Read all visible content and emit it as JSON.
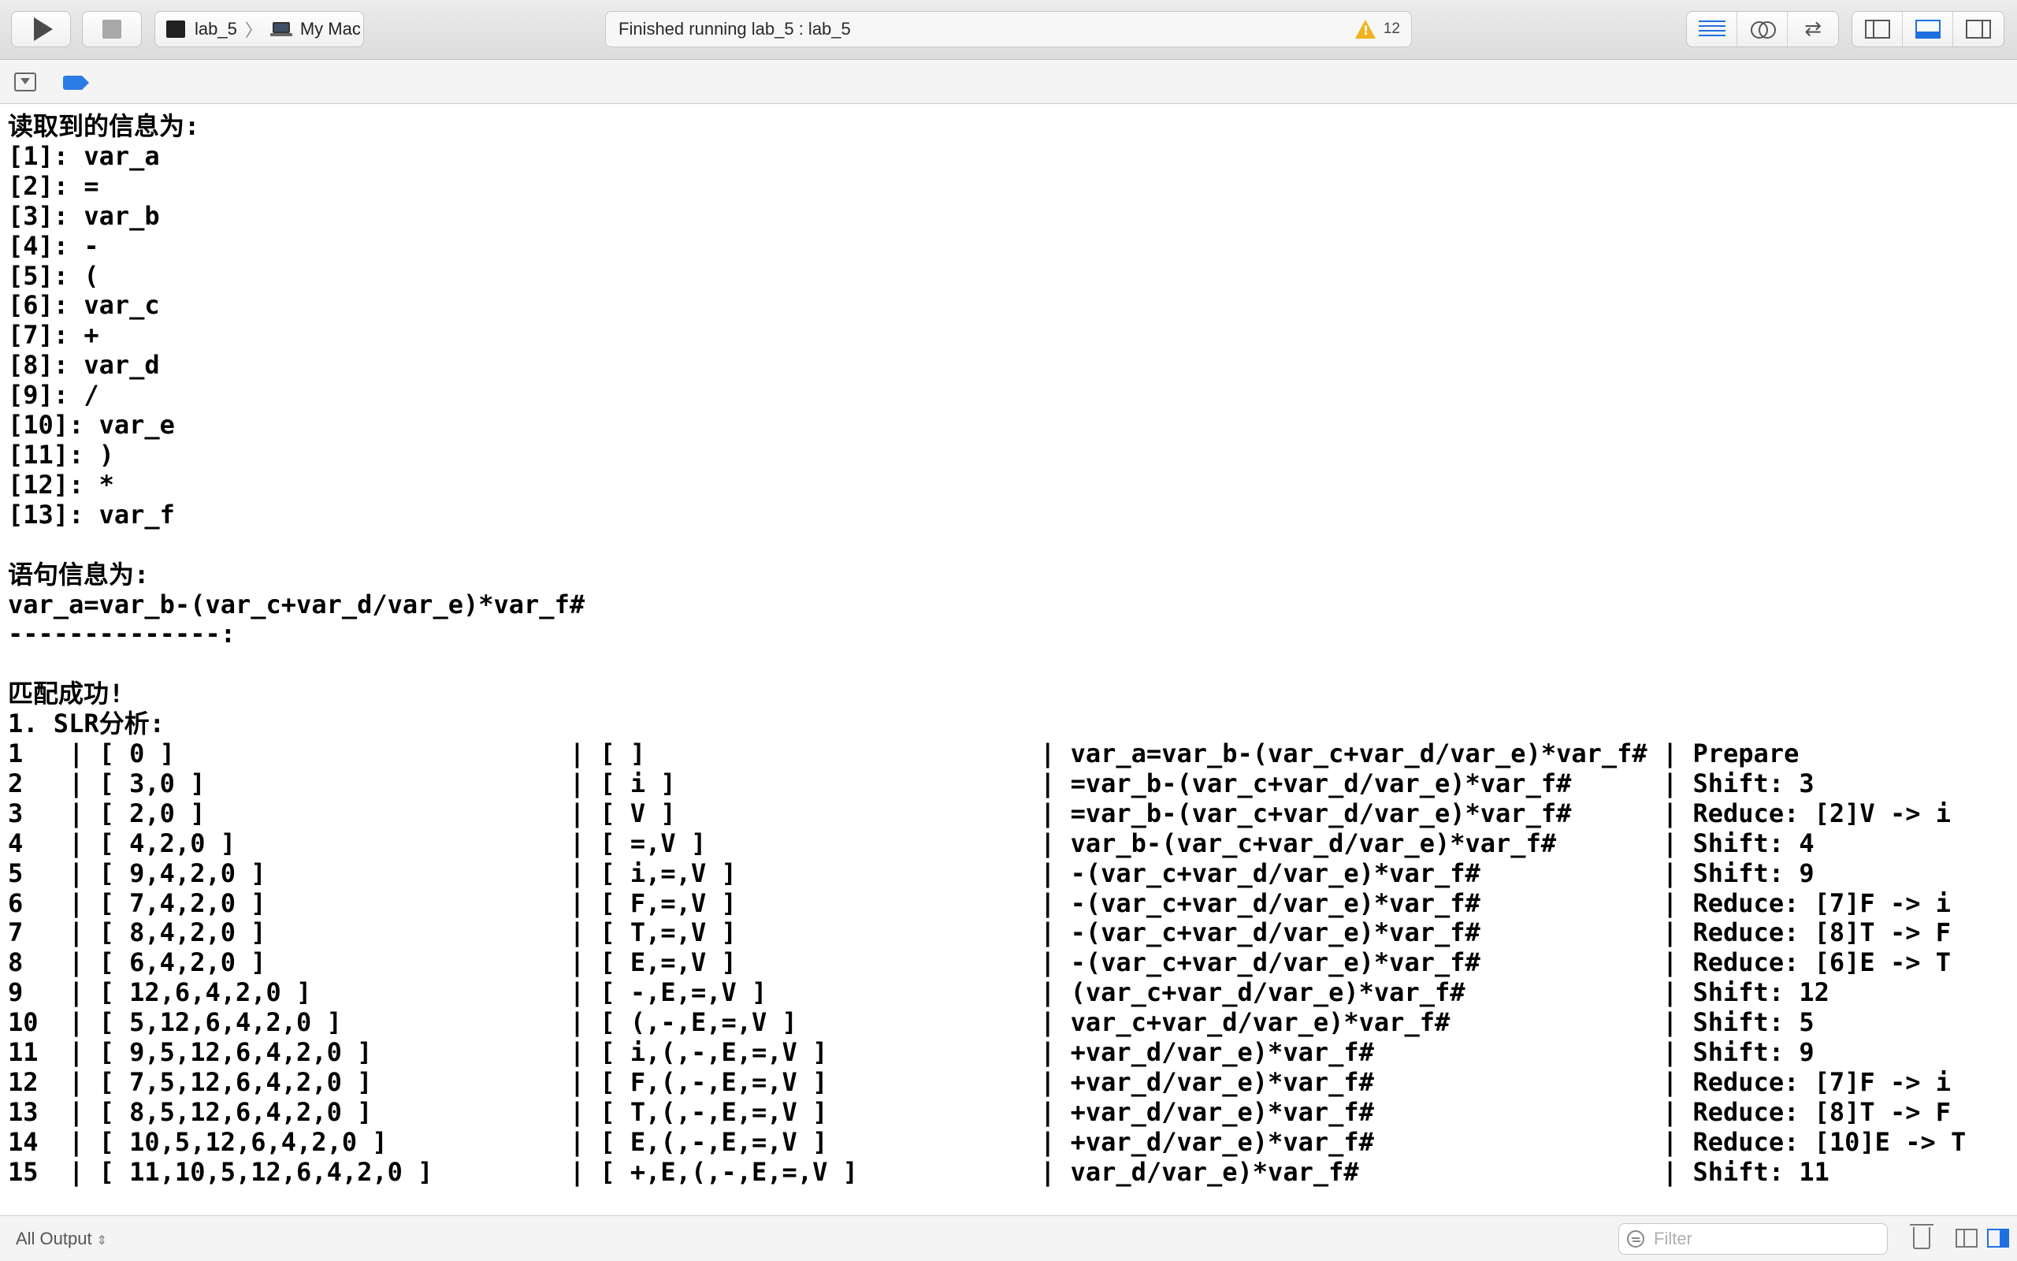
{
  "toolbar": {
    "scheme_target": "lab_5",
    "scheme_destination": "My Mac",
    "status_text": "Finished running lab_5 : lab_5",
    "warning_count": "12"
  },
  "console_lines": [
    "读取到的信息为:",
    "[1]: var_a",
    "[2]: =",
    "[3]: var_b",
    "[4]: -",
    "[5]: (",
    "[6]: var_c",
    "[7]: +",
    "[8]: var_d",
    "[9]: /",
    "[10]: var_e",
    "[11]: )",
    "[12]: *",
    "[13]: var_f",
    "",
    "语句信息为:",
    "var_a=var_b-(var_c+var_d/var_e)*var_f#",
    "--------------:",
    "",
    "匹配成功!",
    "1. SLR分析:",
    "1   | [ 0 ]                          | [ ]                          | var_a=var_b-(var_c+var_d/var_e)*var_f# | Prepare",
    "2   | [ 3,0 ]                        | [ i ]                        | =var_b-(var_c+var_d/var_e)*var_f#      | Shift: 3",
    "3   | [ 2,0 ]                        | [ V ]                        | =var_b-(var_c+var_d/var_e)*var_f#      | Reduce: [2]V -> i",
    "4   | [ 4,2,0 ]                      | [ =,V ]                      | var_b-(var_c+var_d/var_e)*var_f#       | Shift: 4",
    "5   | [ 9,4,2,0 ]                    | [ i,=,V ]                    | -(var_c+var_d/var_e)*var_f#            | Shift: 9",
    "6   | [ 7,4,2,0 ]                    | [ F,=,V ]                    | -(var_c+var_d/var_e)*var_f#            | Reduce: [7]F -> i",
    "7   | [ 8,4,2,0 ]                    | [ T,=,V ]                    | -(var_c+var_d/var_e)*var_f#            | Reduce: [8]T -> F",
    "8   | [ 6,4,2,0 ]                    | [ E,=,V ]                    | -(var_c+var_d/var_e)*var_f#            | Reduce: [6]E -> T",
    "9   | [ 12,6,4,2,0 ]                 | [ -,E,=,V ]                  | (var_c+var_d/var_e)*var_f#             | Shift: 12",
    "10  | [ 5,12,6,4,2,0 ]               | [ (,-,E,=,V ]                | var_c+var_d/var_e)*var_f#              | Shift: 5",
    "11  | [ 9,5,12,6,4,2,0 ]             | [ i,(,-,E,=,V ]              | +var_d/var_e)*var_f#                   | Shift: 9",
    "12  | [ 7,5,12,6,4,2,0 ]             | [ F,(,-,E,=,V ]              | +var_d/var_e)*var_f#                   | Reduce: [7]F -> i",
    "13  | [ 8,5,12,6,4,2,0 ]             | [ T,(,-,E,=,V ]              | +var_d/var_e)*var_f#                   | Reduce: [8]T -> F",
    "14  | [ 10,5,12,6,4,2,0 ]            | [ E,(,-,E,=,V ]              | +var_d/var_e)*var_f#                   | Reduce: [10]E -> T",
    "15  | [ 11,10,5,12,6,4,2,0 ]         | [ +,E,(,-,E,=,V ]            | var_d/var_e)*var_f#                    | Shift: 11"
  ],
  "bottombar": {
    "output_filter_label": "All Output",
    "filter_placeholder": "Filter"
  }
}
